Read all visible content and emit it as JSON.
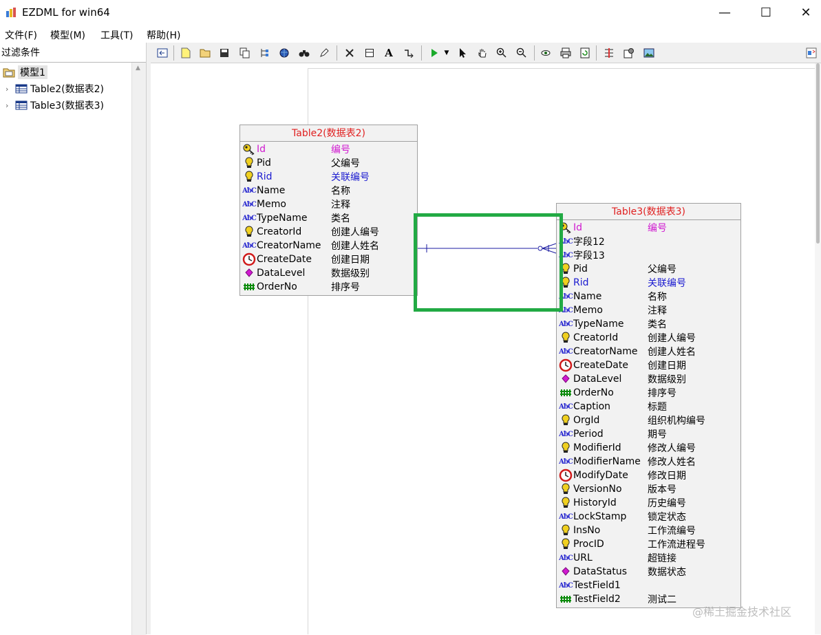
{
  "window": {
    "title": "EZDML for win64",
    "minimize_glyph": "—",
    "maximize_glyph": "☐",
    "close_glyph": "✕"
  },
  "menu": {
    "items": [
      {
        "label": "文件(F)"
      },
      {
        "label": "模型(M)"
      },
      {
        "label": "工具(T)"
      },
      {
        "label": "帮助(H)"
      }
    ]
  },
  "left_panel": {
    "filter_label": "过滤条件",
    "tree": [
      {
        "label": "模型1"
      },
      {
        "label": "Table2(数据表2)"
      },
      {
        "label": "Table3(数据表3)"
      }
    ]
  },
  "toolbar": {
    "icons": [
      "back-icon",
      "new-icon",
      "open-icon",
      "save-icon",
      "copy-icon",
      "tree-icon",
      "globe-icon",
      "binoculars-icon",
      "pencil-icon",
      "delete-icon",
      "rect-icon",
      "text-icon",
      "link-icon",
      "run-icon",
      "dropdown-icon",
      "pointer-icon",
      "hand-icon",
      "zoom-in-icon",
      "zoom-out-icon",
      "eye-icon",
      "print-icon",
      "refresh-icon",
      "import-icon",
      "settings-icon",
      "image-icon",
      "panel-icon"
    ]
  },
  "entities": [
    {
      "title": "Table2(数据表2)",
      "fields": [
        {
          "name": "Id",
          "caption": "编号",
          "icon": "key-icon",
          "kind": "pk"
        },
        {
          "name": "Pid",
          "caption": "父编号",
          "icon": "bulb-icon",
          "kind": "normal"
        },
        {
          "name": "Rid",
          "caption": "关联编号",
          "icon": "bulb-icon",
          "kind": "fk"
        },
        {
          "name": "Name",
          "caption": "名称",
          "icon": "abc-icon",
          "kind": "normal"
        },
        {
          "name": "Memo",
          "caption": "注释",
          "icon": "abc-icon",
          "kind": "normal"
        },
        {
          "name": "TypeName",
          "caption": "类名",
          "icon": "abc-icon",
          "kind": "normal"
        },
        {
          "name": "CreatorId",
          "caption": "创建人编号",
          "icon": "bulb-icon",
          "kind": "normal"
        },
        {
          "name": "CreatorName",
          "caption": "创建人姓名",
          "icon": "abc-icon",
          "kind": "normal"
        },
        {
          "name": "CreateDate",
          "caption": "创建日期",
          "icon": "clock-icon",
          "kind": "normal"
        },
        {
          "name": "DataLevel",
          "caption": "数据级别",
          "icon": "diamond-icon",
          "kind": "normal"
        },
        {
          "name": "OrderNo",
          "caption": "排序号",
          "icon": "hash-icon",
          "kind": "normal"
        }
      ]
    },
    {
      "title": "Table3(数据表3)",
      "fields": [
        {
          "name": "Id",
          "caption": "编号",
          "icon": "key-icon",
          "kind": "pk"
        },
        {
          "name": "字段12",
          "caption": "",
          "icon": "abc-icon",
          "kind": "normal"
        },
        {
          "name": "字段13",
          "caption": "",
          "icon": "abc-icon",
          "kind": "normal"
        },
        {
          "name": "Pid",
          "caption": "父编号",
          "icon": "bulb-icon",
          "kind": "normal"
        },
        {
          "name": "Rid",
          "caption": "关联编号",
          "icon": "bulb-icon",
          "kind": "fk"
        },
        {
          "name": "Name",
          "caption": "名称",
          "icon": "abc-icon",
          "kind": "normal"
        },
        {
          "name": "Memo",
          "caption": "注释",
          "icon": "abc-icon",
          "kind": "normal"
        },
        {
          "name": "TypeName",
          "caption": "类名",
          "icon": "abc-icon",
          "kind": "normal"
        },
        {
          "name": "CreatorId",
          "caption": "创建人编号",
          "icon": "bulb-icon",
          "kind": "normal"
        },
        {
          "name": "CreatorName",
          "caption": "创建人姓名",
          "icon": "abc-icon",
          "kind": "normal"
        },
        {
          "name": "CreateDate",
          "caption": "创建日期",
          "icon": "clock-icon",
          "kind": "normal"
        },
        {
          "name": "DataLevel",
          "caption": "数据级别",
          "icon": "diamond-icon",
          "kind": "normal"
        },
        {
          "name": "OrderNo",
          "caption": "排序号",
          "icon": "hash-icon",
          "kind": "normal"
        },
        {
          "name": "Caption",
          "caption": "标题",
          "icon": "abc-icon",
          "kind": "normal"
        },
        {
          "name": "OrgId",
          "caption": "组织机构编号",
          "icon": "bulb-icon",
          "kind": "normal"
        },
        {
          "name": "Period",
          "caption": "期号",
          "icon": "abc-icon",
          "kind": "normal"
        },
        {
          "name": "ModifierId",
          "caption": "修改人编号",
          "icon": "bulb-icon",
          "kind": "normal"
        },
        {
          "name": "ModifierName",
          "caption": "修改人姓名",
          "icon": "abc-icon",
          "kind": "normal"
        },
        {
          "name": "ModifyDate",
          "caption": "修改日期",
          "icon": "clock-icon",
          "kind": "normal"
        },
        {
          "name": "VersionNo",
          "caption": "版本号",
          "icon": "bulb-icon",
          "kind": "normal"
        },
        {
          "name": "HistoryId",
          "caption": "历史编号",
          "icon": "bulb-icon",
          "kind": "normal"
        },
        {
          "name": "LockStamp",
          "caption": "锁定状态",
          "icon": "abc-icon",
          "kind": "normal"
        },
        {
          "name": "InsNo",
          "caption": "工作流编号",
          "icon": "bulb-icon",
          "kind": "normal"
        },
        {
          "name": "ProcID",
          "caption": "工作流进程号",
          "icon": "bulb-icon",
          "kind": "normal"
        },
        {
          "name": "URL",
          "caption": "超链接",
          "icon": "abc-icon",
          "kind": "normal"
        },
        {
          "name": "DataStatus",
          "caption": "数据状态",
          "icon": "diamond-icon",
          "kind": "normal"
        },
        {
          "name": "TestField1",
          "caption": "",
          "icon": "abc-icon",
          "kind": "normal"
        },
        {
          "name": "TestField2",
          "caption": "测试二",
          "icon": "hash-icon",
          "kind": "normal"
        }
      ]
    }
  ],
  "colors": {
    "title_red": "#e02020",
    "pk_magenta": "#d01ad0",
    "fk_blue": "#1a1ad0",
    "highlight_green": "#22aa44",
    "relation_line": "#1a1aa0"
  },
  "watermark": "@稀土掘金技术社区"
}
